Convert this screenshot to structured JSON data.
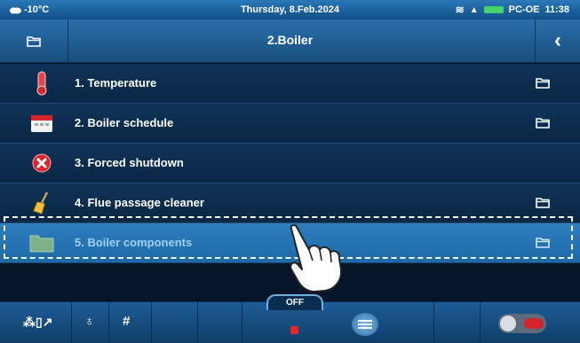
{
  "status": {
    "outdoor_temp": "-10°C",
    "date": "Thursday, 8.Feb.2024",
    "device": "PC-OE",
    "time": "11:38"
  },
  "header": {
    "title": "2.Boiler",
    "back_icon": "chevron-left-icon",
    "folder_icon": "folder-icon"
  },
  "menu": {
    "items": [
      {
        "label": "1. Temperature",
        "icon": "thermometer-icon",
        "has_folder": true
      },
      {
        "label": "2. Boiler schedule",
        "icon": "calendar-icon",
        "has_folder": true
      },
      {
        "label": "3. Forced shutdown",
        "icon": "red-x-icon",
        "has_folder": false
      },
      {
        "label": "4. Flue passage cleaner",
        "icon": "broom-icon",
        "has_folder": true
      },
      {
        "label": "5. Boiler components",
        "icon": "folder-green-icon",
        "has_folder": true,
        "selected": true
      }
    ]
  },
  "bottom": {
    "mode_label": "OFF",
    "icons": [
      "mode-icon",
      "flame-icon",
      "grid-icon",
      "stop-icon",
      "menu-icon",
      "power-toggle"
    ]
  },
  "colors": {
    "statusbar": "#1f6aa8",
    "item_bg": "#0f3358",
    "selected_bg": "#2f7dbd",
    "selected_text": "#9fcff2",
    "stop_red": "#e8262a"
  }
}
